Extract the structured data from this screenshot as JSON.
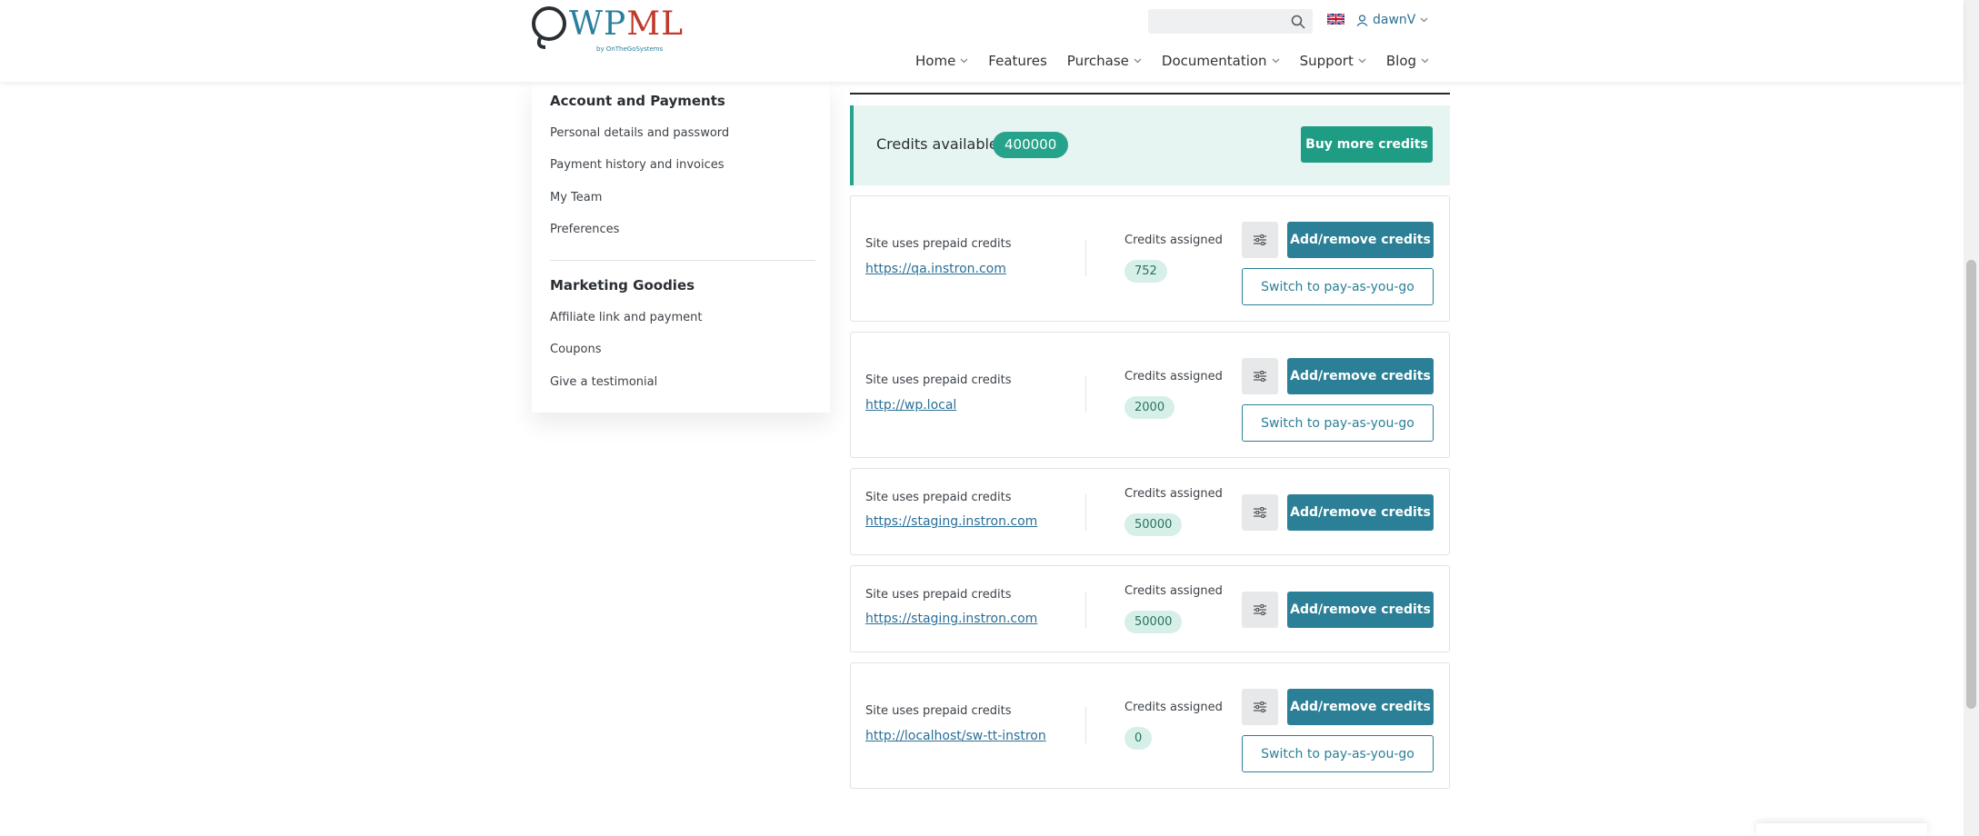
{
  "header": {
    "logo": {
      "wp": "WP",
      "ml": "ML",
      "by": "by OnTheGoSystems"
    },
    "search": {
      "placeholder": ""
    },
    "user": {
      "name": "dawnV"
    },
    "nav": [
      {
        "label": "Home"
      },
      {
        "label": "Features"
      },
      {
        "label": "Purchase"
      },
      {
        "label": "Documentation"
      },
      {
        "label": "Support"
      },
      {
        "label": "Blog"
      }
    ]
  },
  "sidebar": {
    "account_heading": "Account and Payments",
    "account_links": [
      {
        "label": "Personal details and password"
      },
      {
        "label": "Payment history and invoices"
      },
      {
        "label": "My Team"
      },
      {
        "label": "Preferences"
      }
    ],
    "marketing_heading": "Marketing Goodies",
    "marketing_links": [
      {
        "label": "Affiliate link and payment"
      },
      {
        "label": "Coupons"
      },
      {
        "label": "Give a testimonial"
      }
    ]
  },
  "credits": {
    "label": "Credits available",
    "amount": "400000",
    "buy_label": "Buy more credits"
  },
  "sites": [
    {
      "status": "Site uses prepaid credits",
      "url": "https://qa.instron.com",
      "assigned_label": "Credits assigned",
      "assigned": "752",
      "add_label": "Add/remove credits",
      "switch_label": "Switch to pay-as-you-go"
    },
    {
      "status": "Site uses prepaid credits",
      "url": "http://wp.local",
      "assigned_label": "Credits assigned",
      "assigned": "2000",
      "add_label": "Add/remove credits",
      "switch_label": "Switch to pay-as-you-go"
    },
    {
      "status": "Site uses prepaid credits",
      "url": "https://staging.instron.com",
      "assigned_label": "Credits assigned",
      "assigned": "50000",
      "add_label": "Add/remove credits"
    },
    {
      "status": "Site uses prepaid credits",
      "url": "https://staging.instron.com",
      "assigned_label": "Credits assigned",
      "assigned": "50000",
      "add_label": "Add/remove credits"
    },
    {
      "status": "Site uses prepaid credits",
      "url": "http://localhost/sw-tt-instron",
      "assigned_label": "Credits assigned",
      "assigned": "0",
      "add_label": "Add/remove credits",
      "switch_label": "Switch to pay-as-you-go"
    }
  ],
  "colors": {
    "accent": "#27a38c",
    "primary_button": "#2b7f96",
    "link": "#2a6f97"
  },
  "icons": {
    "search": "search-icon",
    "flag": "uk-flag-icon",
    "user": "user-icon",
    "settings": "sliders-icon",
    "chevron": "chevron-down-icon"
  }
}
